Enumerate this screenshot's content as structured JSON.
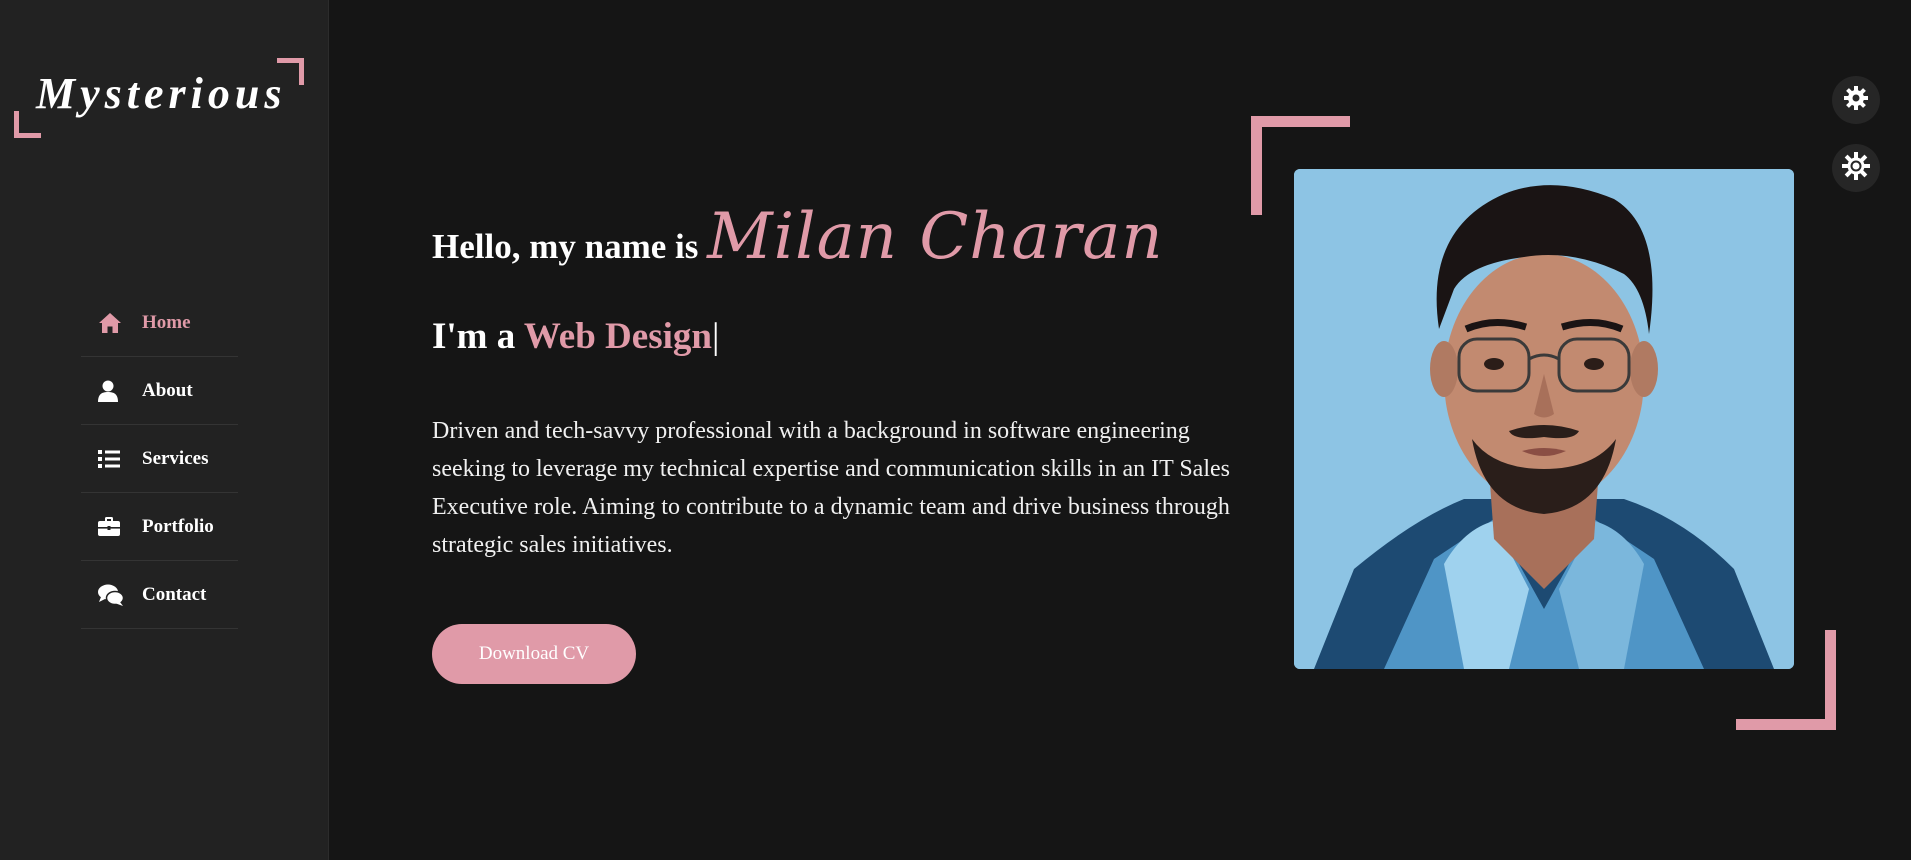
{
  "brand": {
    "logo_text": "Mysterious"
  },
  "sidebar": {
    "items": [
      {
        "label": "Home",
        "icon": "home-icon",
        "active": true
      },
      {
        "label": "About",
        "icon": "user-icon",
        "active": false
      },
      {
        "label": "Services",
        "icon": "list-icon",
        "active": false
      },
      {
        "label": "Portfolio",
        "icon": "briefcase-icon",
        "active": false
      },
      {
        "label": "Contact",
        "icon": "chat-icon",
        "active": false
      }
    ]
  },
  "hero": {
    "greeting": "Hello, my name is",
    "name": "Milan Charan",
    "role_prefix": "I'm a",
    "role": "Web Design",
    "cursor": "|",
    "description": "Driven and tech-savvy professional with a background in software engineering seeking to leverage my technical expertise and communication skills in an IT Sales Executive role. Aiming to contribute to a dynamic team and drive business through strategic sales initiatives.",
    "cta_label": "Download CV"
  },
  "portrait": {
    "icon": "portrait-image"
  },
  "controls": {
    "settings_icon": "gear-icon",
    "theme_icon": "sun-icon"
  },
  "colors": {
    "accent": "#e09aa8",
    "background": "#151515",
    "sidebar": "#222222"
  }
}
